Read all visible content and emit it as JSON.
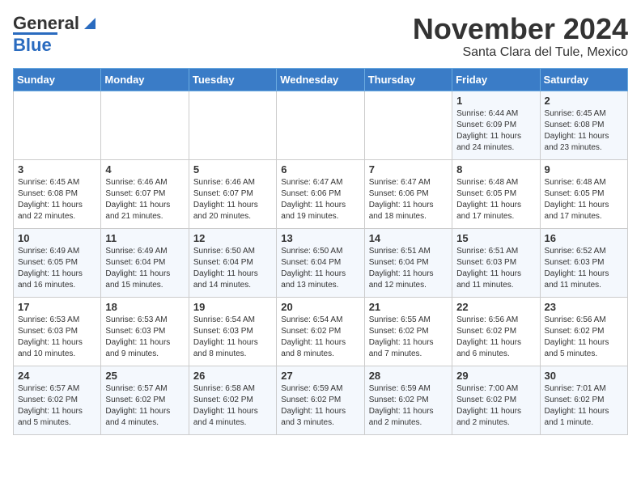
{
  "logo": {
    "general": "General",
    "blue": "Blue"
  },
  "title": "November 2024",
  "subtitle": "Santa Clara del Tule, Mexico",
  "days_of_week": [
    "Sunday",
    "Monday",
    "Tuesday",
    "Wednesday",
    "Thursday",
    "Friday",
    "Saturday"
  ],
  "weeks": [
    [
      {
        "day": "",
        "info": ""
      },
      {
        "day": "",
        "info": ""
      },
      {
        "day": "",
        "info": ""
      },
      {
        "day": "",
        "info": ""
      },
      {
        "day": "",
        "info": ""
      },
      {
        "day": "1",
        "info": "Sunrise: 6:44 AM\nSunset: 6:09 PM\nDaylight: 11 hours and 24 minutes."
      },
      {
        "day": "2",
        "info": "Sunrise: 6:45 AM\nSunset: 6:08 PM\nDaylight: 11 hours and 23 minutes."
      }
    ],
    [
      {
        "day": "3",
        "info": "Sunrise: 6:45 AM\nSunset: 6:08 PM\nDaylight: 11 hours and 22 minutes."
      },
      {
        "day": "4",
        "info": "Sunrise: 6:46 AM\nSunset: 6:07 PM\nDaylight: 11 hours and 21 minutes."
      },
      {
        "day": "5",
        "info": "Sunrise: 6:46 AM\nSunset: 6:07 PM\nDaylight: 11 hours and 20 minutes."
      },
      {
        "day": "6",
        "info": "Sunrise: 6:47 AM\nSunset: 6:06 PM\nDaylight: 11 hours and 19 minutes."
      },
      {
        "day": "7",
        "info": "Sunrise: 6:47 AM\nSunset: 6:06 PM\nDaylight: 11 hours and 18 minutes."
      },
      {
        "day": "8",
        "info": "Sunrise: 6:48 AM\nSunset: 6:05 PM\nDaylight: 11 hours and 17 minutes."
      },
      {
        "day": "9",
        "info": "Sunrise: 6:48 AM\nSunset: 6:05 PM\nDaylight: 11 hours and 17 minutes."
      }
    ],
    [
      {
        "day": "10",
        "info": "Sunrise: 6:49 AM\nSunset: 6:05 PM\nDaylight: 11 hours and 16 minutes."
      },
      {
        "day": "11",
        "info": "Sunrise: 6:49 AM\nSunset: 6:04 PM\nDaylight: 11 hours and 15 minutes."
      },
      {
        "day": "12",
        "info": "Sunrise: 6:50 AM\nSunset: 6:04 PM\nDaylight: 11 hours and 14 minutes."
      },
      {
        "day": "13",
        "info": "Sunrise: 6:50 AM\nSunset: 6:04 PM\nDaylight: 11 hours and 13 minutes."
      },
      {
        "day": "14",
        "info": "Sunrise: 6:51 AM\nSunset: 6:04 PM\nDaylight: 11 hours and 12 minutes."
      },
      {
        "day": "15",
        "info": "Sunrise: 6:51 AM\nSunset: 6:03 PM\nDaylight: 11 hours and 11 minutes."
      },
      {
        "day": "16",
        "info": "Sunrise: 6:52 AM\nSunset: 6:03 PM\nDaylight: 11 hours and 11 minutes."
      }
    ],
    [
      {
        "day": "17",
        "info": "Sunrise: 6:53 AM\nSunset: 6:03 PM\nDaylight: 11 hours and 10 minutes."
      },
      {
        "day": "18",
        "info": "Sunrise: 6:53 AM\nSunset: 6:03 PM\nDaylight: 11 hours and 9 minutes."
      },
      {
        "day": "19",
        "info": "Sunrise: 6:54 AM\nSunset: 6:03 PM\nDaylight: 11 hours and 8 minutes."
      },
      {
        "day": "20",
        "info": "Sunrise: 6:54 AM\nSunset: 6:02 PM\nDaylight: 11 hours and 8 minutes."
      },
      {
        "day": "21",
        "info": "Sunrise: 6:55 AM\nSunset: 6:02 PM\nDaylight: 11 hours and 7 minutes."
      },
      {
        "day": "22",
        "info": "Sunrise: 6:56 AM\nSunset: 6:02 PM\nDaylight: 11 hours and 6 minutes."
      },
      {
        "day": "23",
        "info": "Sunrise: 6:56 AM\nSunset: 6:02 PM\nDaylight: 11 hours and 5 minutes."
      }
    ],
    [
      {
        "day": "24",
        "info": "Sunrise: 6:57 AM\nSunset: 6:02 PM\nDaylight: 11 hours and 5 minutes."
      },
      {
        "day": "25",
        "info": "Sunrise: 6:57 AM\nSunset: 6:02 PM\nDaylight: 11 hours and 4 minutes."
      },
      {
        "day": "26",
        "info": "Sunrise: 6:58 AM\nSunset: 6:02 PM\nDaylight: 11 hours and 4 minutes."
      },
      {
        "day": "27",
        "info": "Sunrise: 6:59 AM\nSunset: 6:02 PM\nDaylight: 11 hours and 3 minutes."
      },
      {
        "day": "28",
        "info": "Sunrise: 6:59 AM\nSunset: 6:02 PM\nDaylight: 11 hours and 2 minutes."
      },
      {
        "day": "29",
        "info": "Sunrise: 7:00 AM\nSunset: 6:02 PM\nDaylight: 11 hours and 2 minutes."
      },
      {
        "day": "30",
        "info": "Sunrise: 7:01 AM\nSunset: 6:02 PM\nDaylight: 11 hours and 1 minute."
      }
    ]
  ]
}
